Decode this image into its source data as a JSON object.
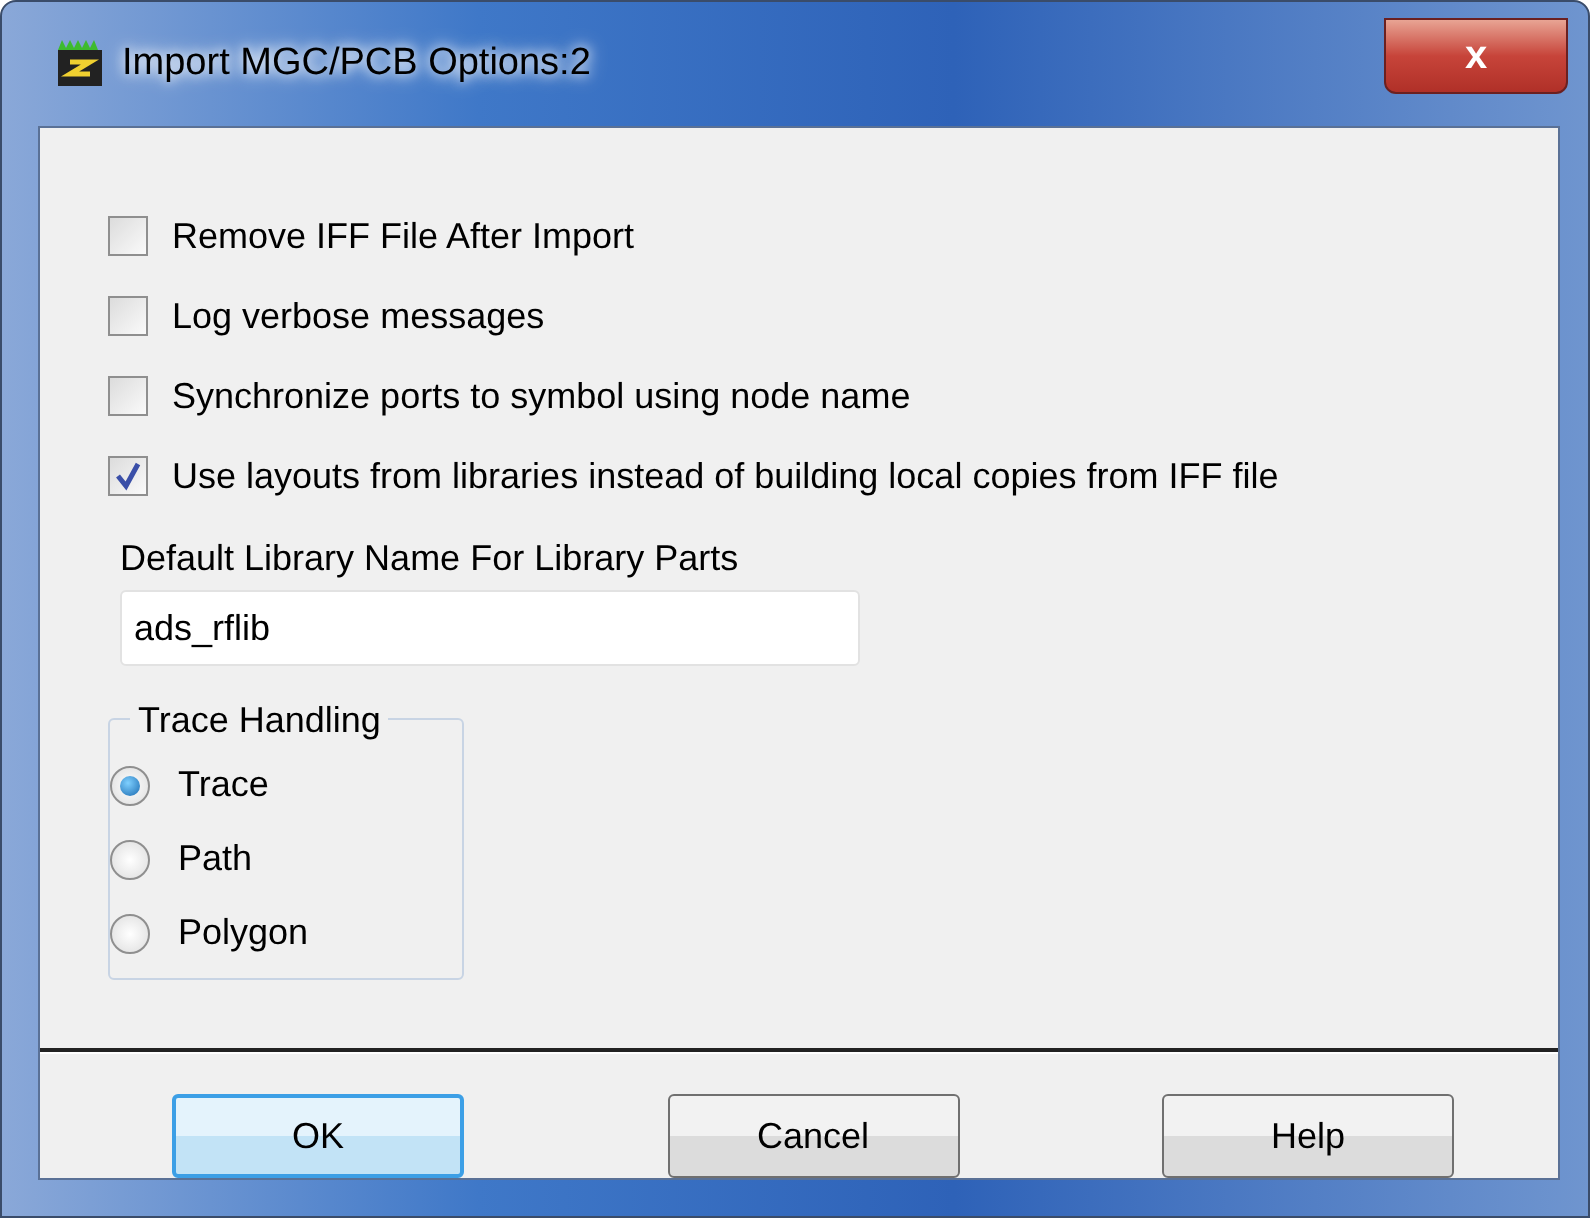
{
  "window": {
    "title": "Import MGC/PCB Options:2",
    "close_glyph": "x"
  },
  "options": [
    {
      "label": "Remove IFF File After Import",
      "checked": false
    },
    {
      "label": "Log verbose messages",
      "checked": false
    },
    {
      "label": "Synchronize ports to symbol using node name",
      "checked": false
    },
    {
      "label": "Use layouts from libraries instead of building local copies from IFF file",
      "checked": true
    }
  ],
  "library_name": {
    "label": "Default Library Name For Library Parts",
    "value": "ads_rflib"
  },
  "trace_handling": {
    "title": "Trace Handling",
    "choices": [
      {
        "label": "Trace",
        "selected": true
      },
      {
        "label": "Path",
        "selected": false
      },
      {
        "label": "Polygon",
        "selected": false
      }
    ]
  },
  "buttons": [
    {
      "label": "OK",
      "default": true
    },
    {
      "label": "Cancel",
      "default": false
    },
    {
      "label": "Help",
      "default": false
    }
  ]
}
